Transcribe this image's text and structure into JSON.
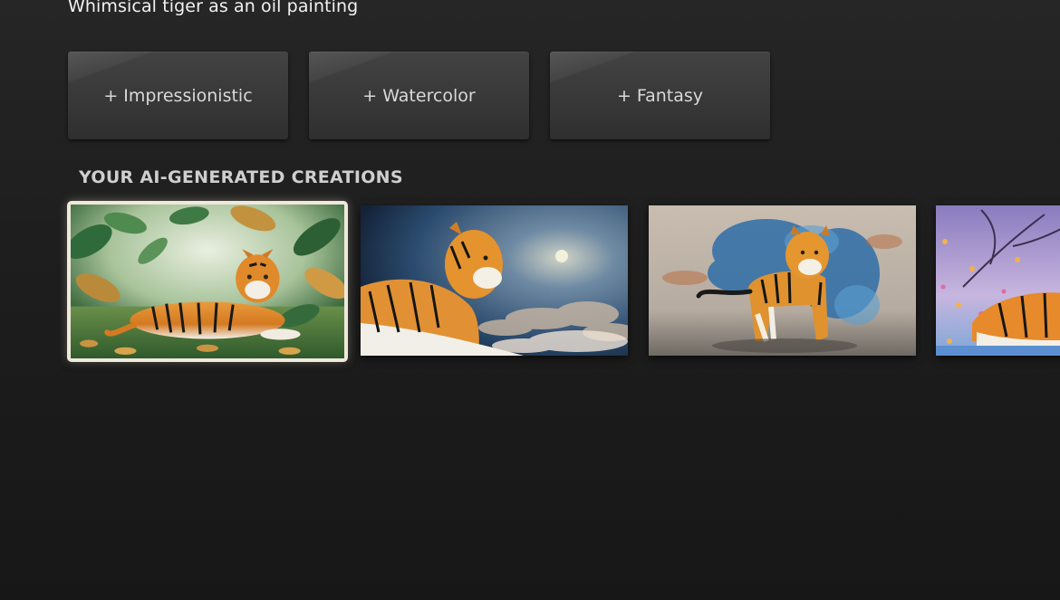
{
  "prompt": {
    "text": "Whimsical tiger as an oil painting"
  },
  "style_chips": [
    {
      "label": "+ Impressionistic"
    },
    {
      "label": "+ Watercolor"
    },
    {
      "label": "+ Fantasy"
    }
  ],
  "creations": {
    "heading": "YOUR AI-GENERATED CREATIONS",
    "items": [
      {
        "icon": "tiger-jungle-image",
        "focused": true
      },
      {
        "icon": "tiger-moonlit-clouds-image",
        "focused": false
      },
      {
        "icon": "tiger-blue-smoke-image",
        "focused": false
      },
      {
        "icon": "tiger-purple-tree-image",
        "focused": false
      }
    ]
  },
  "colors": {
    "background": "#1b1b1b",
    "chip": "#3b3b3b",
    "focus_border": "#efe8dc",
    "text": "#f2f2f2"
  }
}
